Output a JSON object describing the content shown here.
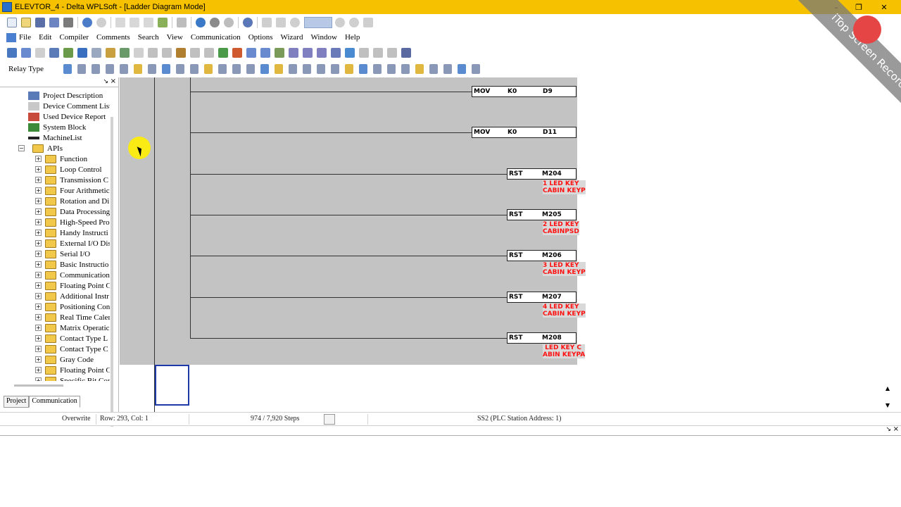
{
  "window": {
    "title": "ELEVTOR_4 - Delta WPLSoft - [Ladder Diagram Mode]",
    "minimize": "–",
    "restore": "❐",
    "close": "✕"
  },
  "menu": [
    "File",
    "Edit",
    "Compiler",
    "Comments",
    "Search",
    "View",
    "Communication",
    "Options",
    "Wizard",
    "Window",
    "Help"
  ],
  "toolbar3": {
    "relay_type_label": "Relay Type"
  },
  "left_panel": {
    "pin": "↘",
    "close": "×",
    "tree": [
      {
        "label": "Project Description",
        "level": 1,
        "icon": "doc-icon"
      },
      {
        "label": "Device Comment List",
        "level": 1,
        "icon": "list-icon"
      },
      {
        "label": "Used Device Report",
        "level": 1,
        "icon": "report-icon"
      },
      {
        "label": "System Block",
        "level": 1,
        "icon": "block-icon"
      },
      {
        "label": "MachineList",
        "level": 1,
        "icon": "machine-icon"
      },
      {
        "label": "APIs",
        "level": 1,
        "icon": "folder-icon",
        "expanded": true
      },
      {
        "label": "Function",
        "level": 2,
        "icon": "folder-icon"
      },
      {
        "label": "Loop Control",
        "level": 2,
        "icon": "folder-icon"
      },
      {
        "label": "Transmission C",
        "level": 2,
        "icon": "folder-icon"
      },
      {
        "label": "Four Arithmetic",
        "level": 2,
        "icon": "folder-icon"
      },
      {
        "label": "Rotation and Di",
        "level": 2,
        "icon": "folder-icon"
      },
      {
        "label": "Data Processing",
        "level": 2,
        "icon": "folder-icon"
      },
      {
        "label": "High-Speed Pro",
        "level": 2,
        "icon": "folder-icon"
      },
      {
        "label": "Handy Instructi",
        "level": 2,
        "icon": "folder-icon"
      },
      {
        "label": "External I/O Dis",
        "level": 2,
        "icon": "folder-icon"
      },
      {
        "label": "Serial I/O",
        "level": 2,
        "icon": "folder-icon"
      },
      {
        "label": "Basic Instructio",
        "level": 2,
        "icon": "folder-icon"
      },
      {
        "label": "Communication",
        "level": 2,
        "icon": "folder-icon"
      },
      {
        "label": "Floating Point C",
        "level": 2,
        "icon": "folder-icon"
      },
      {
        "label": "Additional Instr",
        "level": 2,
        "icon": "folder-icon"
      },
      {
        "label": "Positioning Con",
        "level": 2,
        "icon": "folder-icon"
      },
      {
        "label": "Real Time Caler",
        "level": 2,
        "icon": "folder-icon"
      },
      {
        "label": "Matrix Operatic",
        "level": 2,
        "icon": "folder-icon"
      },
      {
        "label": "Contact Type L",
        "level": 2,
        "icon": "folder-icon"
      },
      {
        "label": "Contact Type C",
        "level": 2,
        "icon": "folder-icon"
      },
      {
        "label": "Gray Code",
        "level": 2,
        "icon": "folder-icon"
      },
      {
        "label": "Floating Point C",
        "level": 2,
        "icon": "folder-icon"
      },
      {
        "label": "Specific Bit Cor",
        "level": 2,
        "icon": "folder-icon"
      }
    ],
    "tabs": [
      "Project",
      "Communication"
    ]
  },
  "ladder": {
    "rungs": [
      {
        "instr": "MOV",
        "op1": "K0",
        "op2": "D9",
        "comment": []
      },
      {
        "instr": "MOV",
        "op1": "K0",
        "op2": "D11",
        "comment": []
      },
      {
        "instr": "RST",
        "op1": "",
        "op2": "M204",
        "comment": [
          "1 LED KEY",
          "CABIN KEYP"
        ]
      },
      {
        "instr": "RST",
        "op1": "",
        "op2": "M205",
        "comment": [
          "2 LED KEY",
          "CABINPSD"
        ]
      },
      {
        "instr": "RST",
        "op1": "",
        "op2": "M206",
        "comment": [
          "3 LED KEY",
          "CABIN KEYP"
        ]
      },
      {
        "instr": "RST",
        "op1": "",
        "op2": "M207",
        "comment": [
          "4 LED KEY",
          "CABIN KEYP"
        ]
      },
      {
        "instr": "RST",
        "op1": "",
        "op2": "M208",
        "comment": [
          " LED KEY C",
          "ABIN KEYPA"
        ]
      }
    ]
  },
  "status": {
    "mode": "Overwrite",
    "position": "Row: 293, Col: 1",
    "steps": "974 / 7,920 Steps",
    "station": "SS2 (PLC Station Address: 1)"
  },
  "output_panel": {
    "pin": "↘",
    "close": "×"
  },
  "watermark": {
    "text": "iTop Screen Recorder"
  }
}
